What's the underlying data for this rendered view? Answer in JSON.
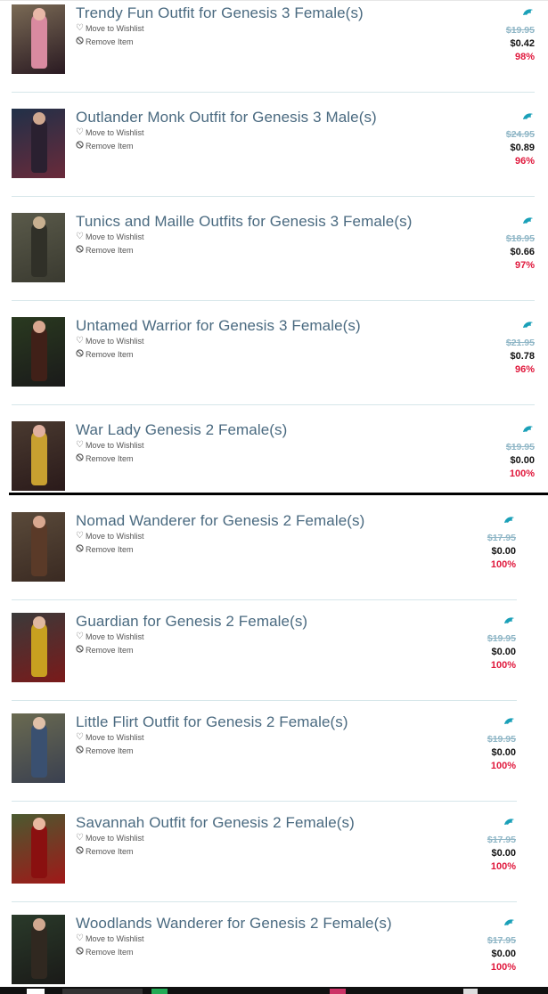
{
  "colors": {
    "title": "#4a6a80",
    "old_price": "#8fb6c6",
    "discount": "#e0183c",
    "separator": "#d6e6ea",
    "dolphin": "#1aa0b8"
  },
  "actions": {
    "wishlist_label": "Move to Wishlist",
    "remove_label": "Remove Item",
    "wishlist_icon": "heart-outline-icon",
    "remove_icon": "prohibited-icon",
    "badge_icon": "dolphin-icon"
  },
  "cart_top": [
    {
      "title": "Trendy Fun Outfit for Genesis 3 Female(s)",
      "old_price": "$19.95",
      "new_price": "$0.42",
      "discount": "98%"
    },
    {
      "title": "Outlander Monk Outfit for Genesis 3 Male(s)",
      "old_price": "$24.95",
      "new_price": "$0.89",
      "discount": "96%"
    },
    {
      "title": "Tunics and Maille Outfits for Genesis 3 Female(s)",
      "old_price": "$18.95",
      "new_price": "$0.66",
      "discount": "97%"
    },
    {
      "title": "Untamed Warrior for Genesis 3 Female(s)",
      "old_price": "$21.95",
      "new_price": "$0.78",
      "discount": "96%"
    },
    {
      "title": "War Lady Genesis 2 Female(s)",
      "old_price": "$19.95",
      "new_price": "$0.00",
      "discount": "100%"
    }
  ],
  "cart_bottom": [
    {
      "title": "Nomad Wanderer for Genesis 2 Female(s)",
      "old_price": "$17.95",
      "new_price": "$0.00",
      "discount": "100%"
    },
    {
      "title": "Guardian for Genesis 2 Female(s)",
      "old_price": "$19.95",
      "new_price": "$0.00",
      "discount": "100%"
    },
    {
      "title": "Little Flirt Outfit for Genesis 2 Female(s)",
      "old_price": "$19.95",
      "new_price": "$0.00",
      "discount": "100%"
    },
    {
      "title": "Savannah Outfit for Genesis 2 Female(s)",
      "old_price": "$17.95",
      "new_price": "$0.00",
      "discount": "100%"
    },
    {
      "title": "Woodlands Wanderer for Genesis 2 Female(s)",
      "old_price": "$17.95",
      "new_price": "$0.00",
      "discount": "100%"
    }
  ]
}
